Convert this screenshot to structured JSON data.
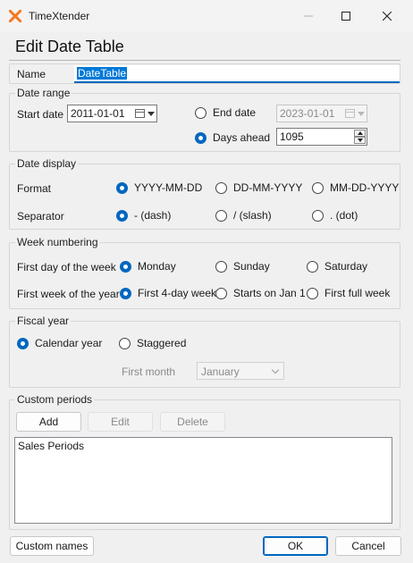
{
  "window": {
    "title": "TimeXtender",
    "minimize_icon": "minimize-icon",
    "maximize_icon": "maximize-icon",
    "close_icon": "close-icon",
    "app_icon": "timextender-x-logo-icon",
    "accent_color": "#f47920"
  },
  "heading": "Edit Date Table",
  "name": {
    "label": "Name",
    "value": "DateTable"
  },
  "date_range": {
    "legend": "Date range",
    "start_label": "Start date",
    "start_value": "2011-01-01",
    "end_option": "End date",
    "end_value": "2023-01-01",
    "days_option": "Days ahead",
    "days_value": "1095",
    "selected": "Days ahead"
  },
  "date_display": {
    "legend": "Date display",
    "format_label": "Format",
    "format_options": [
      "YYYY-MM-DD",
      "DD-MM-YYYY",
      "MM-DD-YYYY"
    ],
    "format_selected": "YYYY-MM-DD",
    "separator_label": "Separator",
    "separator_options": [
      "- (dash)",
      "/ (slash)",
      ". (dot)"
    ],
    "separator_selected": "- (dash)"
  },
  "week_numbering": {
    "legend": "Week numbering",
    "first_day_label": "First day of the week",
    "first_day_options": [
      "Monday",
      "Sunday",
      "Saturday"
    ],
    "first_day_selected": "Monday",
    "first_week_label": "First week of the year",
    "first_week_options": [
      "First 4-day week",
      "Starts on Jan 1",
      "First full week"
    ],
    "first_week_selected": "First 4-day week"
  },
  "fiscal_year": {
    "legend": "Fiscal year",
    "options": [
      "Calendar year",
      "Staggered"
    ],
    "selected": "Calendar year",
    "first_month_label": "First month",
    "first_month_value": "January"
  },
  "custom_periods": {
    "legend": "Custom periods",
    "add_label": "Add",
    "edit_label": "Edit",
    "delete_label": "Delete",
    "items": [
      "Sales Periods"
    ]
  },
  "footer": {
    "custom_names_label": "Custom names",
    "ok_label": "OK",
    "cancel_label": "Cancel"
  },
  "colors": {
    "accent": "#0067c0",
    "selection": "#0078d7"
  }
}
